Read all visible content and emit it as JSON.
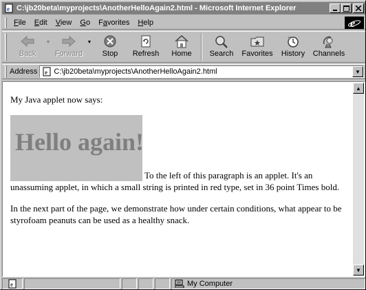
{
  "window": {
    "title": "C:\\jb20beta\\myprojects\\AnotherHelloAgain2.html - Microsoft Internet Explorer",
    "controls": [
      "minimize",
      "maximize",
      "close"
    ]
  },
  "menu": {
    "items": [
      {
        "label": "File",
        "accel": "F"
      },
      {
        "label": "Edit",
        "accel": "E"
      },
      {
        "label": "View",
        "accel": "V"
      },
      {
        "label": "Go",
        "accel": "G"
      },
      {
        "label": "Favorites",
        "accel": "a"
      },
      {
        "label": "Help",
        "accel": "H"
      }
    ]
  },
  "toolbar": {
    "back": "Back",
    "forward": "Forward",
    "stop": "Stop",
    "refresh": "Refresh",
    "home": "Home",
    "search": "Search",
    "favorites": "Favorites",
    "history": "History",
    "channels": "Channels"
  },
  "address": {
    "label": "Address",
    "url": "C:\\jb20beta\\myprojects\\AnotherHelloAgain2.html"
  },
  "page": {
    "intro": "My Java applet now says:",
    "applet_text": "Hello again!",
    "para1": "To the left of this paragraph is an applet. It's an unassuming applet, in which a small string is printed in red type, set in 36 point Times bold.",
    "para2": "In the next part of the page, we demonstrate how under certain conditions, what appear to be styrofoam peanuts can be used as a healthy snack."
  },
  "status": {
    "zone": "My Computer"
  },
  "colors": {
    "titlebar_inactive": "#808080",
    "chrome": "#c0c0c0",
    "applet_bg": "#c0c0c0",
    "applet_text": "#7f7f7f"
  }
}
